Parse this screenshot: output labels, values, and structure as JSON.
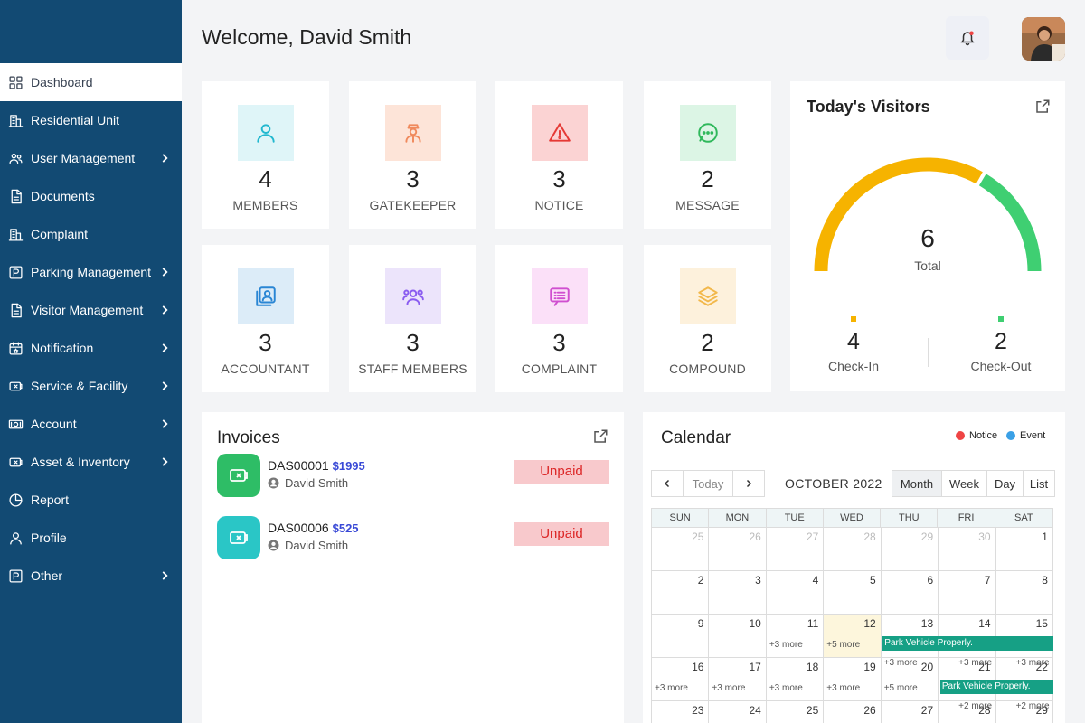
{
  "header": {
    "welcome": "Welcome, David Smith"
  },
  "sidebar": {
    "items": [
      {
        "label": "Dashboard",
        "icon": "grid-icon",
        "active": true,
        "chevron": false
      },
      {
        "label": "Residential Unit",
        "icon": "building-icon",
        "chevron": false
      },
      {
        "label": "User Management",
        "icon": "users-icon",
        "chevron": true
      },
      {
        "label": "Documents",
        "icon": "document-icon",
        "chevron": false
      },
      {
        "label": "Complaint",
        "icon": "building-icon",
        "chevron": false
      },
      {
        "label": "Parking Management",
        "icon": "parking-icon",
        "chevron": true
      },
      {
        "label": "Visitor Management",
        "icon": "document-icon",
        "chevron": true
      },
      {
        "label": "Notification",
        "icon": "calendar-icon",
        "chevron": true
      },
      {
        "label": "Service & Facility",
        "icon": "ticket-icon",
        "chevron": true
      },
      {
        "label": "Account",
        "icon": "cash-icon",
        "chevron": true
      },
      {
        "label": "Asset & Inventory",
        "icon": "ticket-icon",
        "chevron": true
      },
      {
        "label": "Report",
        "icon": "pie-chart-icon",
        "chevron": false
      },
      {
        "label": "Profile",
        "icon": "user-icon",
        "chevron": false
      },
      {
        "label": "Other",
        "icon": "parking-icon",
        "chevron": true
      }
    ]
  },
  "stats": [
    {
      "value": "4",
      "label": "MEMBERS",
      "icon": "user-icon",
      "bg": "#dff5f8",
      "fg": "#22b8cf"
    },
    {
      "value": "3",
      "label": "GATEKEEPER",
      "icon": "guard-icon",
      "bg": "#fde4d8",
      "fg": "#f08a5d"
    },
    {
      "value": "3",
      "label": "NOTICE",
      "icon": "warning-icon",
      "bg": "#fbd3d3",
      "fg": "#e53935"
    },
    {
      "value": "2",
      "label": "MESSAGE",
      "icon": "chat-icon",
      "bg": "#dcf5e5",
      "fg": "#2fb85b"
    },
    {
      "value": "3",
      "label": "ACCOUNTANT",
      "icon": "contacts-icon",
      "bg": "#dcecf8",
      "fg": "#2a86d4"
    },
    {
      "value": "3",
      "label": "STAFF MEMBERS",
      "icon": "team-icon",
      "bg": "#ece4fb",
      "fg": "#8a5cf0"
    },
    {
      "value": "3",
      "label": "COMPLAINT",
      "icon": "list-icon",
      "bg": "#fbe0f8",
      "fg": "#d04fd0"
    },
    {
      "value": "2",
      "label": "COMPOUND",
      "icon": "layers-icon",
      "bg": "#fdf1dc",
      "fg": "#f2b84b"
    }
  ],
  "visitors": {
    "title": "Today's Visitors",
    "total": "6",
    "total_label": "Total",
    "checkin": {
      "value": "4",
      "label": "Check-In",
      "color": "#f6b300"
    },
    "checkout": {
      "value": "2",
      "label": "Check-Out",
      "color": "#3fcf72"
    }
  },
  "invoices": {
    "title": "Invoices",
    "items": [
      {
        "id": "DAS00001",
        "amount": "$1995",
        "user": "David Smith",
        "status": "Unpaid",
        "color": "#2ebd66"
      },
      {
        "id": "DAS00006",
        "amount": "$525",
        "user": "David Smith",
        "status": "Unpaid",
        "color": "#2ac6c6"
      }
    ]
  },
  "calendar": {
    "title": "Calendar",
    "legend_notice": "Notice",
    "legend_event": "Event",
    "notice_color": "#ef4444",
    "event_color": "#3aa0e6",
    "today_btn": "Today",
    "month_label": "OCTOBER 2022",
    "views": [
      "Month",
      "Week",
      "Day",
      "List"
    ],
    "weekdays": [
      "SUN",
      "MON",
      "TUE",
      "WED",
      "THU",
      "FRI",
      "SAT"
    ],
    "weeks": [
      [
        {
          "d": "25",
          "m": true
        },
        {
          "d": "26",
          "m": true
        },
        {
          "d": "27",
          "m": true
        },
        {
          "d": "28",
          "m": true
        },
        {
          "d": "29",
          "m": true
        },
        {
          "d": "30",
          "m": true
        },
        {
          "d": "1"
        }
      ],
      [
        {
          "d": "2"
        },
        {
          "d": "3"
        },
        {
          "d": "4"
        },
        {
          "d": "5"
        },
        {
          "d": "6"
        },
        {
          "d": "7"
        },
        {
          "d": "8"
        }
      ],
      [
        {
          "d": "9"
        },
        {
          "d": "10"
        },
        {
          "d": "11",
          "more": "+3 more"
        },
        {
          "d": "12",
          "more": "+5 more",
          "today": true
        },
        {
          "d": "13"
        },
        {
          "d": "14"
        },
        {
          "d": "15"
        }
      ],
      [
        {
          "d": "16",
          "more": "+3 more"
        },
        {
          "d": "17",
          "more": "+3 more"
        },
        {
          "d": "18",
          "more": "+3 more"
        },
        {
          "d": "19",
          "more": "+3 more"
        },
        {
          "d": "20",
          "more": "+5 more",
          "more_top": "+3 more"
        },
        {
          "d": "21",
          "more_top": "+3 more"
        },
        {
          "d": "22",
          "more_top": "+3 more"
        }
      ],
      [
        {
          "d": "23"
        },
        {
          "d": "24"
        },
        {
          "d": "25"
        },
        {
          "d": "26"
        },
        {
          "d": "27"
        },
        {
          "d": "28",
          "more_top": "+2 more"
        },
        {
          "d": "29",
          "more_top": "+2 more"
        }
      ]
    ],
    "events": [
      {
        "label": "Park Vehicle Properly.",
        "week": 2,
        "start": 4,
        "end": 6
      },
      {
        "label": "Park Vehicle Properly.",
        "week": 3,
        "start": 5,
        "end": 6
      }
    ]
  }
}
